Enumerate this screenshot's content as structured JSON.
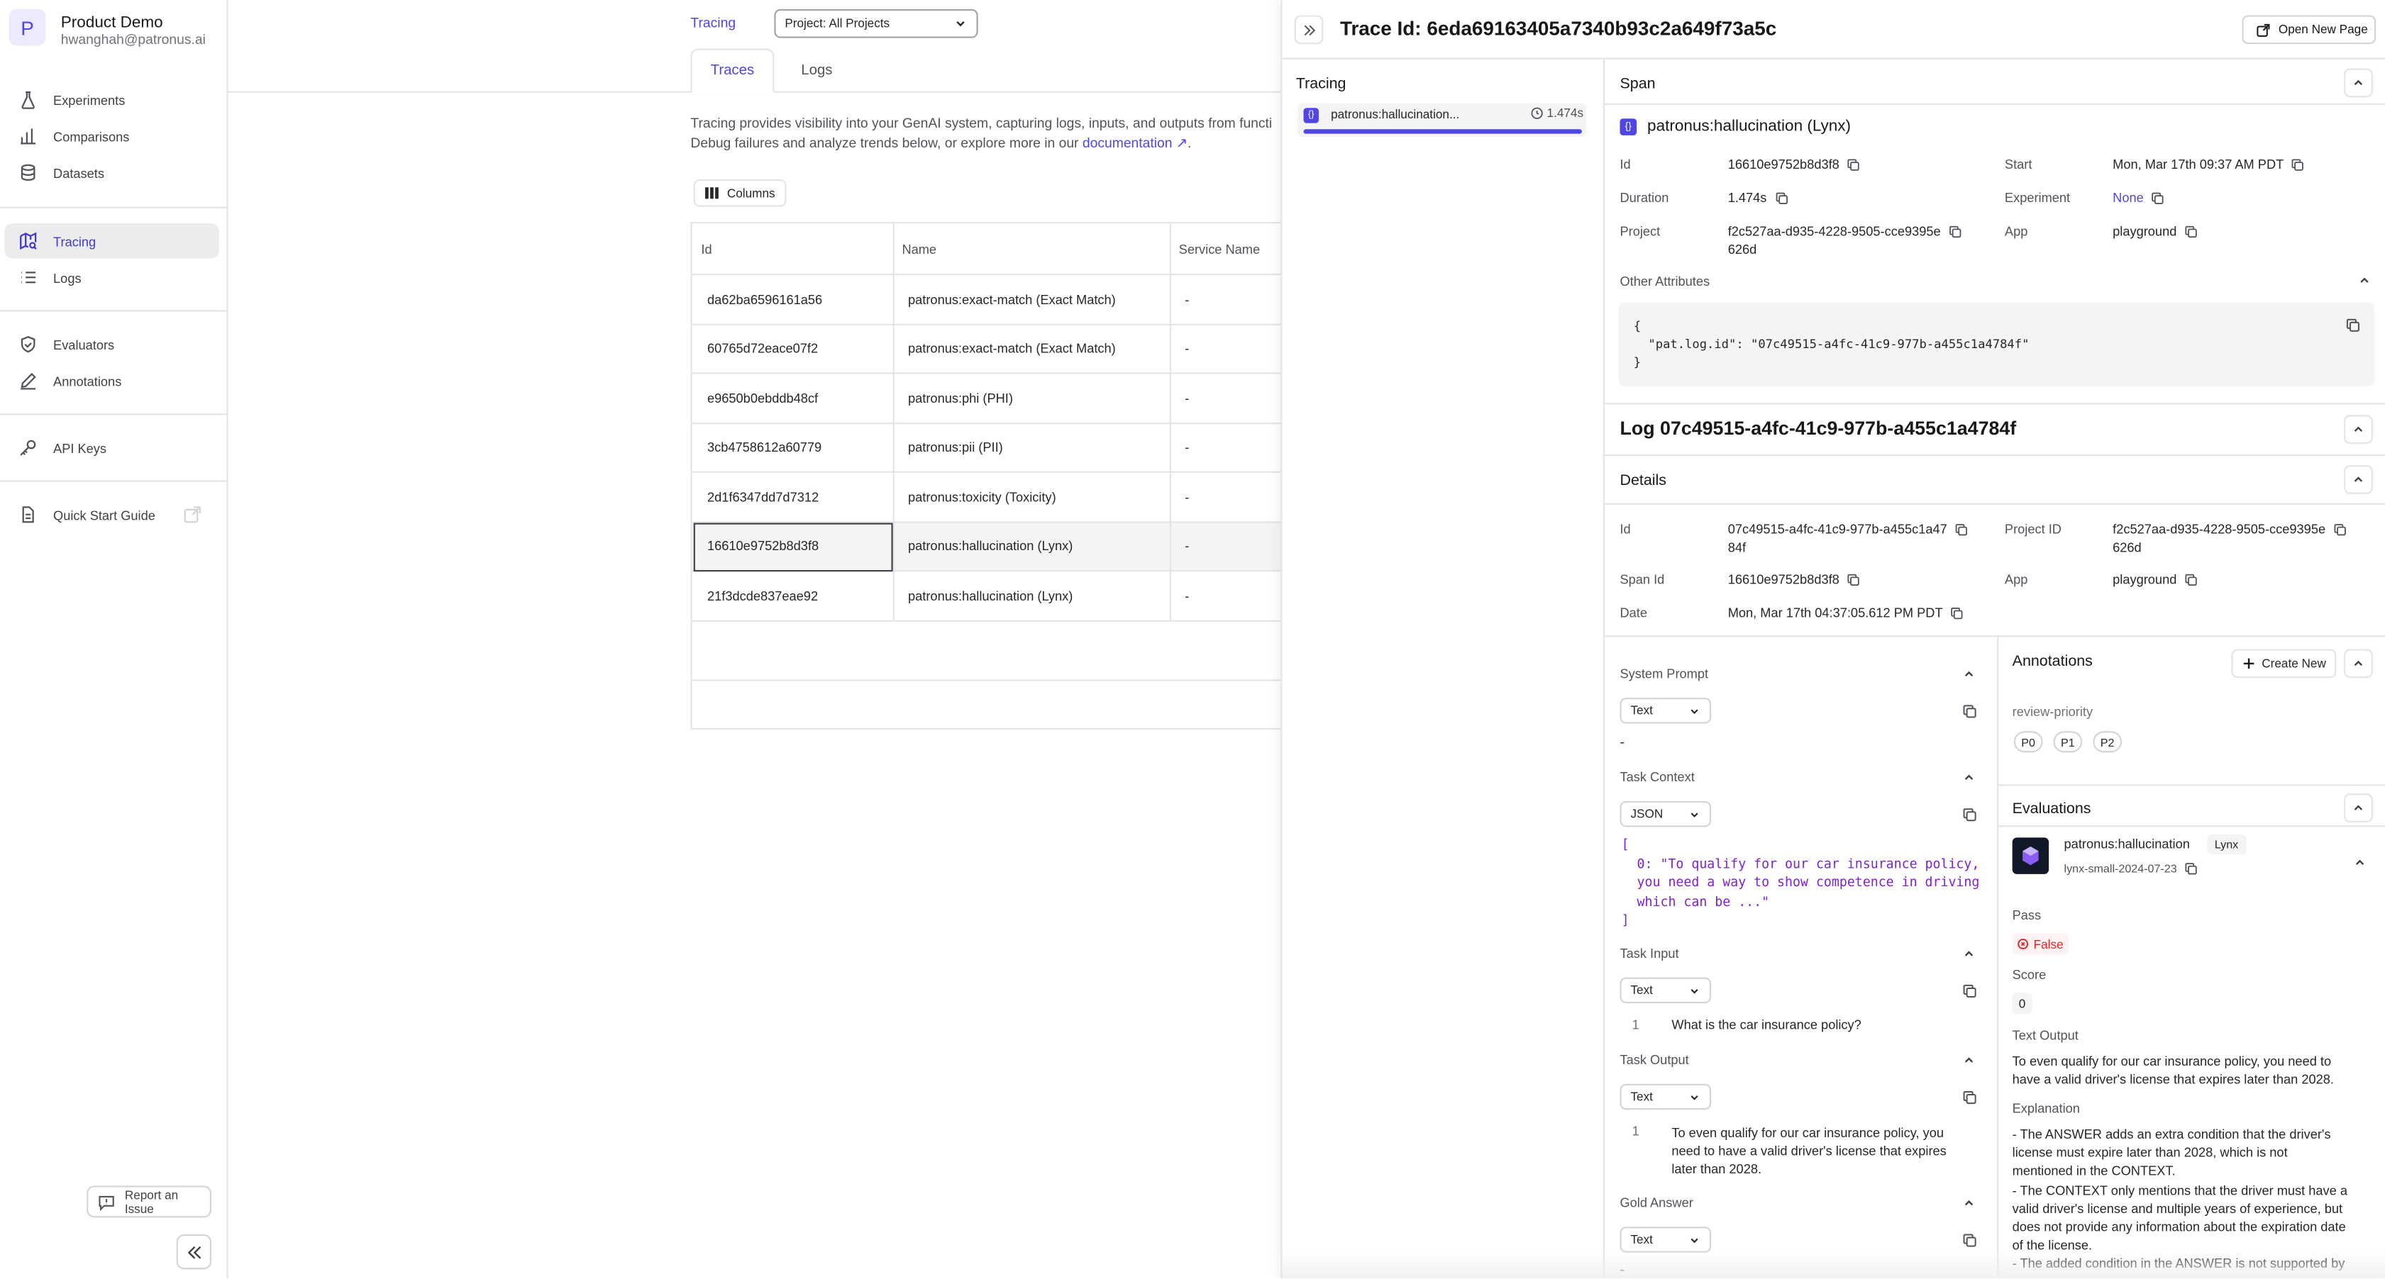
{
  "org": {
    "initial": "P",
    "name": "Product Demo",
    "email": "hwanghah@patronus.ai"
  },
  "sidebar": {
    "items": [
      {
        "label": "Experiments",
        "icon": "flask-icon"
      },
      {
        "label": "Comparisons",
        "icon": "bar-chart-icon"
      },
      {
        "label": "Datasets",
        "icon": "database-icon"
      },
      {
        "label": "Tracing",
        "icon": "map-search-icon",
        "active": true
      },
      {
        "label": "Logs",
        "icon": "list-icon"
      },
      {
        "label": "Evaluators",
        "icon": "shield-check-icon"
      },
      {
        "label": "Annotations",
        "icon": "pencil-icon"
      },
      {
        "label": "API Keys",
        "icon": "key-icon"
      },
      {
        "label": "Quick Start Guide",
        "icon": "document-icon"
      }
    ],
    "report_issue": "Report an Issue"
  },
  "main": {
    "breadcrumb": "Tracing",
    "project_select": "Project: All Projects",
    "tabs": [
      "Traces",
      "Logs"
    ],
    "description_line1": "Tracing provides visibility into your GenAI system, capturing logs, inputs, and outputs from functi",
    "description_line2": "Debug failures and analyze trends below, or explore more in our",
    "description_link": "documentation",
    "columns_button": "Columns",
    "table": {
      "headers": [
        "Id",
        "Name",
        "Service Name"
      ],
      "rows": [
        [
          "da62ba6596161a56",
          "patronus:exact-match (Exact Match)",
          "-"
        ],
        [
          "60765d72eace07f2",
          "patronus:exact-match (Exact Match)",
          "-"
        ],
        [
          "e9650b0ebddb48cf",
          "patronus:phi (PHI)",
          "-"
        ],
        [
          "3cb4758612a60779",
          "patronus:pii (PII)",
          "-"
        ],
        [
          "2d1f6347dd7d7312",
          "patronus:toxicity (Toxicity)",
          "-"
        ],
        [
          "16610e9752b8d3f8",
          "patronus:hallucination (Lynx)",
          "-"
        ],
        [
          "21f3dcde837eae92",
          "patronus:hallucination (Lynx)",
          "-"
        ]
      ]
    }
  },
  "trace": {
    "title": "Trace Id: 6eda69163405a7340b93c2a649f73a5c",
    "open_new_page": "Open New Page",
    "tracing_label": "Tracing",
    "span_item": {
      "name": "patronus:hallucination...",
      "duration": "1.474s"
    },
    "span": {
      "section": "Span",
      "name": "patronus:hallucination (Lynx)",
      "id_label": "Id",
      "id": "16610e9752b8d3f8",
      "start_label": "Start",
      "start": "Mon, Mar 17th 09:37 AM PDT",
      "duration_label": "Duration",
      "duration": "1.474s",
      "experiment_label": "Experiment",
      "experiment": "None",
      "project_label": "Project",
      "project_line1": "f2c527aa-d935-4228-9505-cce9395e",
      "project_line2": "626d",
      "app_label": "App",
      "app": "playground",
      "other_attributes": "Other Attributes",
      "attr_code": "{\n  \"pat.log.id\": \"07c49515-a4fc-41c9-977b-a455c1a4784f\"\n}"
    },
    "log": {
      "title": "Log 07c49515-a4fc-41c9-977b-a455c1a4784f",
      "details": "Details",
      "id_label": "Id",
      "id_line1": "07c49515-a4fc-41c9-977b-a455c1a47",
      "id_line2": "84f",
      "project_id_label": "Project ID",
      "project_id_line1": "f2c527aa-d935-4228-9505-cce9395e",
      "project_id_line2": "626d",
      "span_id_label": "Span Id",
      "span_id": "16610e9752b8d3f8",
      "app_label": "App",
      "app": "playground",
      "date_label": "Date",
      "date": "Mon, Mar 17th 04:37:05.612 PM PDT"
    },
    "io": {
      "system_prompt": {
        "label": "System Prompt",
        "format": "Text",
        "value": "-"
      },
      "task_context": {
        "label": "Task Context",
        "format": "JSON",
        "code": "[\n  0: \"To qualify for our car insurance policy,\n  you need a way to show competence in driving\n  which can be ...\"\n]"
      },
      "task_input": {
        "label": "Task Input",
        "format": "Text",
        "line": "1",
        "value": "What is the car insurance policy?"
      },
      "task_output": {
        "label": "Task Output",
        "format": "Text",
        "line": "1",
        "value_l1": "To even qualify for our car insurance policy, you",
        "value_l2": "need to have a valid driver's license that expires",
        "value_l3": "later than 2028."
      },
      "gold_answer": {
        "label": "Gold Answer",
        "format": "Text",
        "value": "-"
      }
    },
    "annotations": {
      "title": "Annotations",
      "create": "Create New",
      "field": "review-priority",
      "options": [
        "P0",
        "P1",
        "P2"
      ]
    },
    "evaluations": {
      "title": "Evaluations",
      "name": "patronus:hallucination",
      "badge": "Lynx",
      "model": "lynx-small-2024-07-23",
      "pass_label": "Pass",
      "pass_value": "False",
      "score_label": "Score",
      "score_value": "0",
      "text_output_label": "Text Output",
      "text_output_l1": "To even qualify for our car insurance policy, you need to",
      "text_output_l2": "have a valid driver's license that expires later than 2028.",
      "explanation_label": "Explanation",
      "explanation_lines": [
        "- The ANSWER adds an extra condition that the driver's",
        "license must expire later than 2028, which is not",
        "mentioned in the CONTEXT.",
        "- The CONTEXT only mentions that the driver must have a",
        "valid driver's license and multiple years of experience, but",
        "does not provide any information about the expiration date",
        "of the license.",
        "- The added condition in the ANSWER is not supported by"
      ]
    }
  },
  "colors": {
    "accent": "#4f46e5",
    "danger": "#dc2626",
    "json": "#7e22ce"
  }
}
